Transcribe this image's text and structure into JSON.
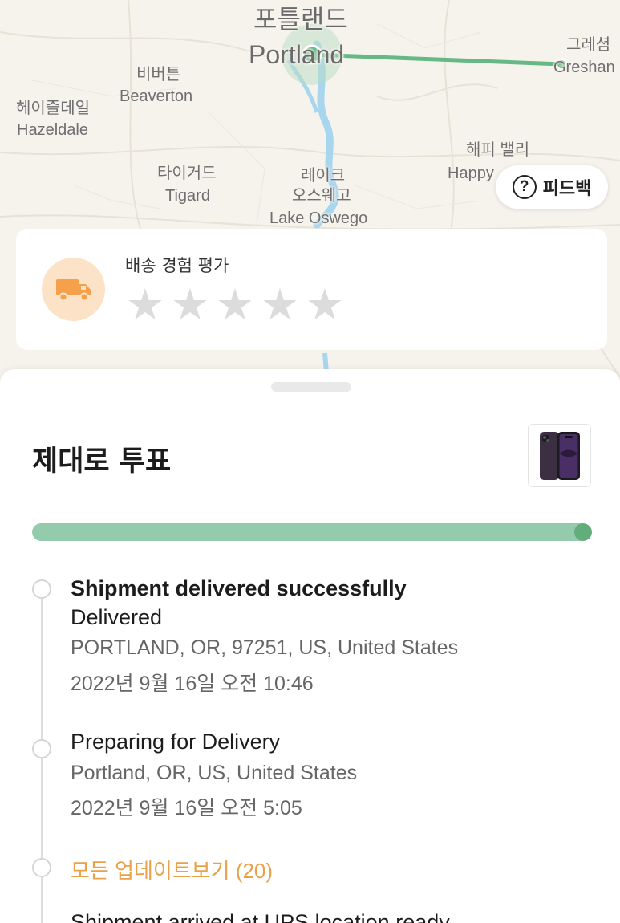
{
  "map": {
    "labels": {
      "portland_ko": "포틀랜드",
      "portland_en": "Portland",
      "gresham_ko": "그레셤",
      "gresham_en": "Greshan",
      "beaverton_ko": "비버튼",
      "beaverton_en": "Beaverton",
      "hazeldale_ko": "헤이즐데일",
      "hazeldale_en": "Hazeldale",
      "happy_valley_ko": "해피 밸리",
      "happy_valley_en": "Happy",
      "tigard_ko": "타이거드",
      "tigard_en": "Tigard",
      "lake_oswego_ko": "레이크\n오스웨고",
      "lake_oswego_ko_1": "레이크",
      "lake_oswego_ko_2": "오스웨고",
      "lake_oswego_en": "Lake Oswego"
    },
    "route_color": "#66b884",
    "feedback_button": {
      "label": "피드백",
      "icon": "question-circle-icon"
    }
  },
  "rating": {
    "title": "배송 경험 평가",
    "icon": "truck-icon",
    "icon_color": "#f5a04a",
    "stars_total": 5,
    "stars_selected": 0
  },
  "sheet": {
    "title": "제대로 투표",
    "product_image": "smartphone-icon",
    "progress_fraction": 1.0,
    "progress_color": "#93cbac"
  },
  "timeline": {
    "events": [
      {
        "title": "Shipment delivered successfully",
        "status": "Delivered",
        "location": "PORTLAND, OR, 97251, US, United States",
        "time": "2022년 9월 16일  오전 10:46"
      },
      {
        "title": "Preparing for Delivery",
        "location": "Portland, OR, US, United States",
        "time": "2022년 9월 16일  오전 5:05"
      }
    ],
    "view_all": "모든 업데이트보기 (20)",
    "truncated_next": "Shipment arrived at UPS location ready"
  }
}
